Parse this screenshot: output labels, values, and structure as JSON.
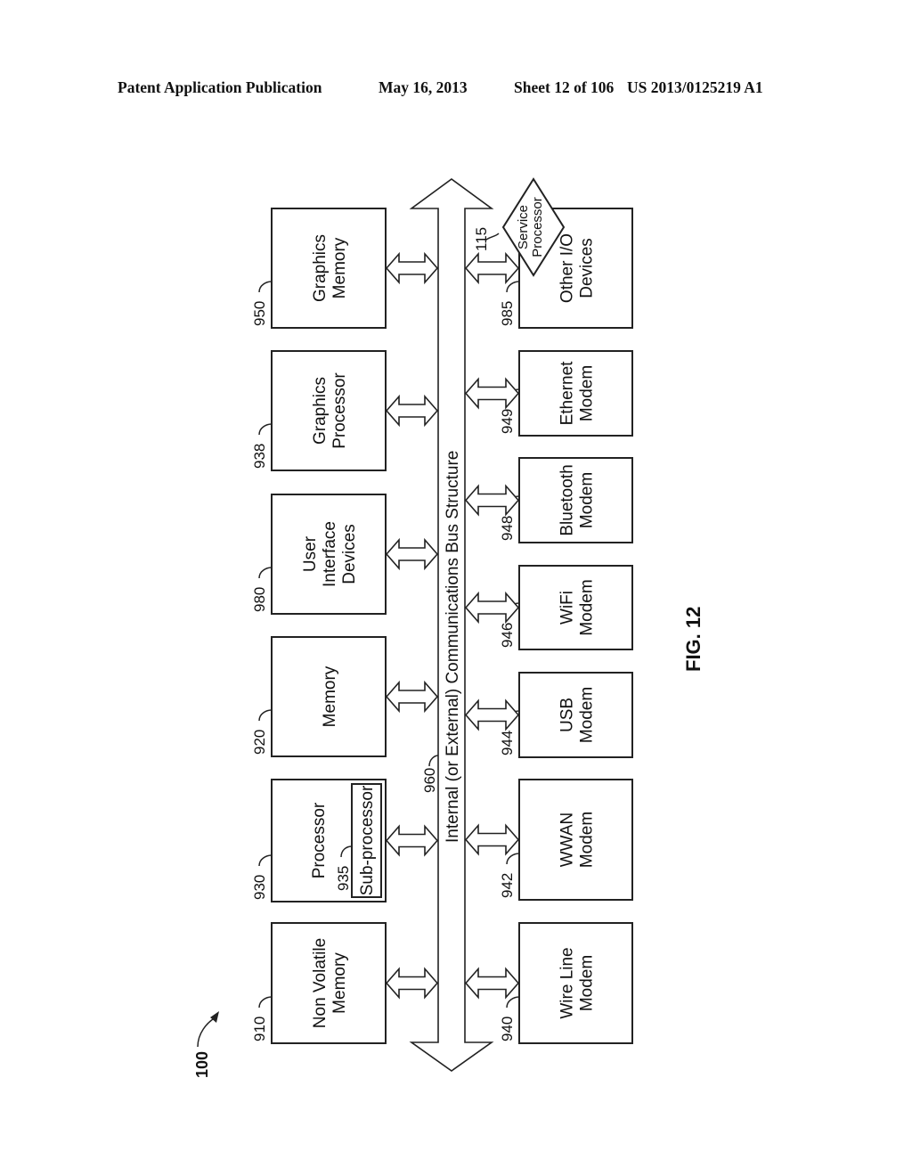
{
  "header": {
    "publication": "Patent Application Publication",
    "date": "May 16, 2013",
    "sheet": "Sheet 12 of 106",
    "number": "US 2013/0125219 A1"
  },
  "figure": {
    "label": "FIG. 12",
    "system_ref": "100"
  },
  "bus": {
    "ref": "960",
    "label": "Internal (or External) Communications Bus Structure"
  },
  "left_components": [
    {
      "ref": "950",
      "lines": [
        "Graphics",
        "Memory"
      ]
    },
    {
      "ref": "938",
      "lines": [
        "Graphics",
        "Processor"
      ]
    },
    {
      "ref": "980",
      "lines": [
        "User",
        "Interface",
        "Devices"
      ]
    },
    {
      "ref": "920",
      "lines": [
        "Memory"
      ]
    },
    {
      "ref": "930",
      "lines": [
        "Processor"
      ],
      "sub": {
        "ref": "935",
        "label": "Sub-processor"
      }
    },
    {
      "ref": "910",
      "lines": [
        "Non Volatile",
        "Memory"
      ]
    }
  ],
  "right_components": [
    {
      "ref": "985",
      "lines": [
        "Other I/O",
        "Devices"
      ]
    },
    {
      "ref": "949",
      "lines": [
        "Ethernet",
        "Modem"
      ]
    },
    {
      "ref": "948",
      "lines": [
        "Bluetooth",
        "Modem"
      ]
    },
    {
      "ref": "946",
      "lines": [
        "WiFi",
        "Modem"
      ]
    },
    {
      "ref": "944",
      "lines": [
        "USB",
        "Modem"
      ]
    },
    {
      "ref": "942",
      "lines": [
        "WWAN",
        "Modem"
      ]
    },
    {
      "ref": "940",
      "lines": [
        "Wire Line",
        "Modem"
      ]
    }
  ],
  "service_processor": {
    "ref": "115",
    "lines": [
      "Service",
      "Processor"
    ]
  }
}
